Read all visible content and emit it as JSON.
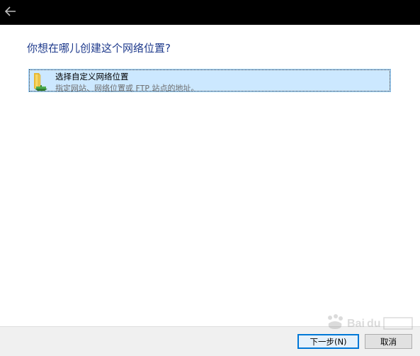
{
  "window": {
    "back_icon": "arrow-left-icon",
    "heading": "你想在哪儿创建这个网络位置?"
  },
  "options": [
    {
      "title": "选择自定义网络位置",
      "description": "指定网站、网络位置或 FTP 站点的地址。",
      "icon": "network-folder-icon",
      "selected": true
    }
  ],
  "footer": {
    "next_label": "下一步(N)",
    "cancel_label": "取消"
  },
  "colors": {
    "titlebar": "#000000",
    "heading": "#1e3a8c",
    "selection_bg": "#cce8ff",
    "selection_border": "#99d1ff",
    "footer_bg": "#f0f0f0",
    "default_button_border": "#0078d7"
  }
}
